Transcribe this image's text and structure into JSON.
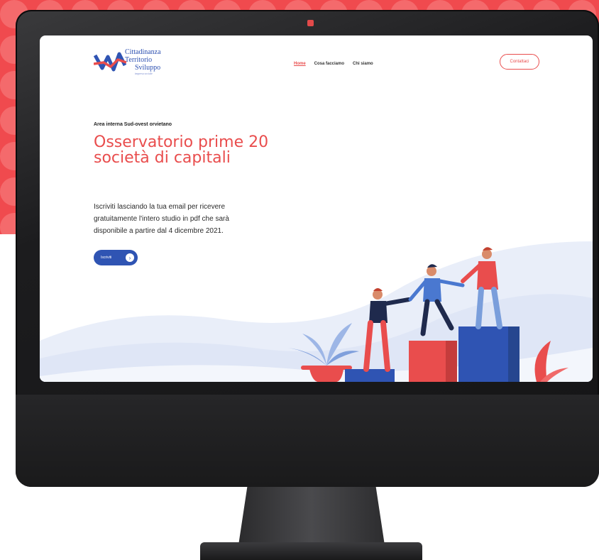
{
  "site": {
    "logo": {
      "line1": "Cittadinanza",
      "line2": "Territorio",
      "line3": "Sviluppo",
      "tagline": "impresa sociale"
    },
    "nav": {
      "links": [
        "Home",
        "Cosa facciamo",
        "Chi siamo"
      ],
      "active_index": 0
    },
    "contact_button": "Contattaci",
    "hero": {
      "eyebrow": "Area interna Sud-ovest orvietano",
      "headline": "Osservatorio prime 20 società di capitali",
      "lead": "Iscriviti lasciando la tua email per ricevere gratuitamente l'intero studio in pdf che sarà disponibile a partire dal 4 dicembre 2021.",
      "cta_label": "Iscriviti",
      "cta_icon": "chevron-right-icon"
    }
  },
  "colors": {
    "accent_red": "#e94d4d",
    "brand_blue": "#2f54b3",
    "wave_light": "#e8eef9",
    "monitor_dark": "#1c1c1e"
  }
}
